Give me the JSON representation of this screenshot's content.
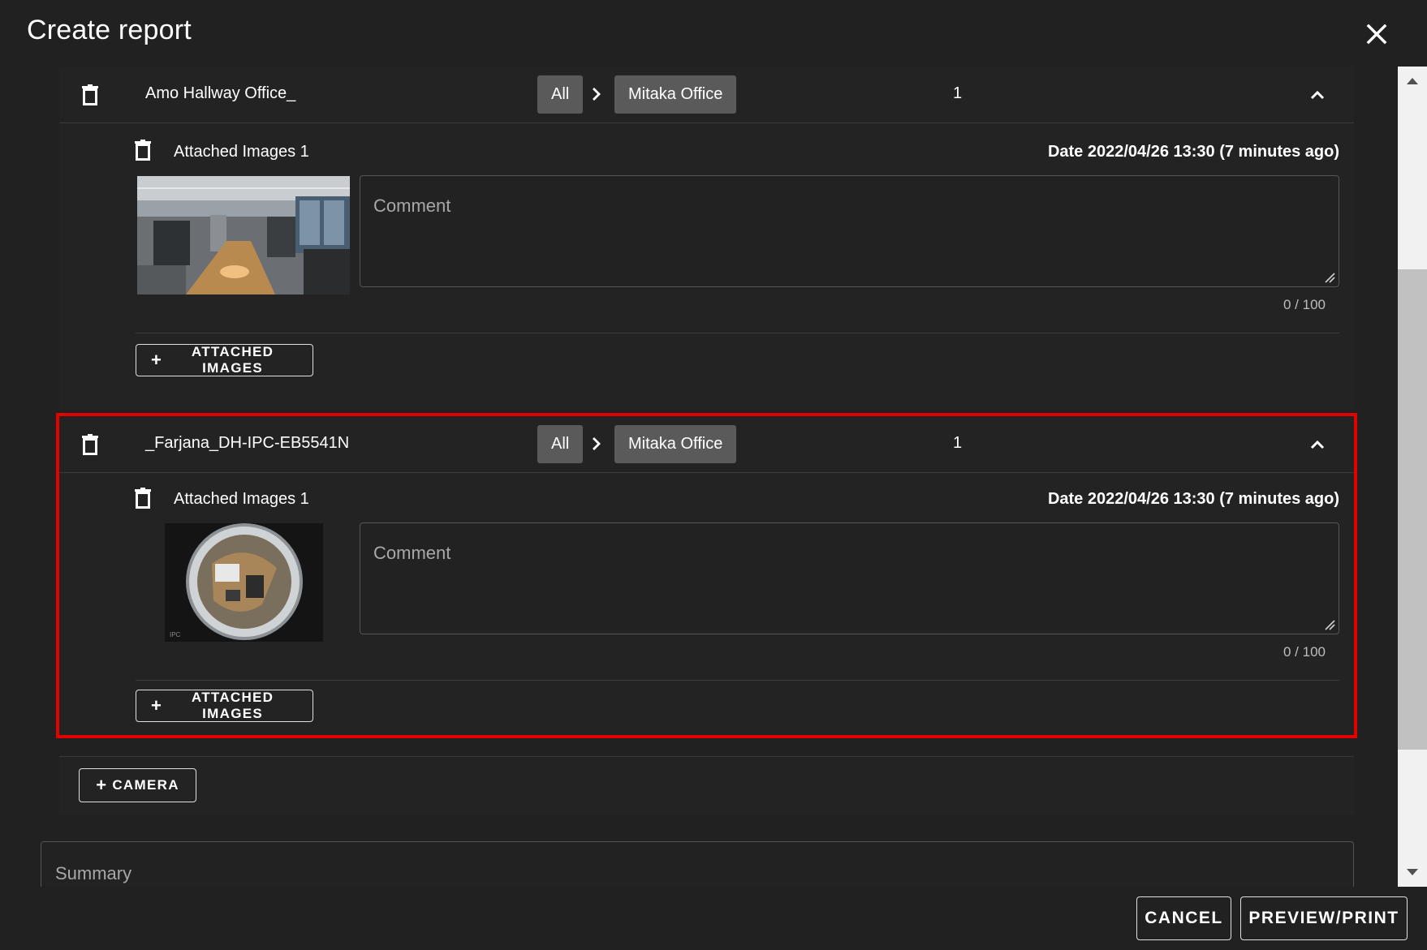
{
  "dialog": {
    "title": "Create report",
    "close_icon": "close-icon"
  },
  "cameras": [
    {
      "name": "Amo Hallway Office_",
      "breadcrumb_root": "All",
      "breadcrumb_location": "Mitaka Office",
      "count": "1",
      "attached_images_label": "Attached Images 1",
      "date": "Date 2022/04/26 13:30 (7 minutes ago)",
      "comment_placeholder": "Comment",
      "char_counter": "0 / 100",
      "add_images_label": "ATTACHED IMAGES"
    },
    {
      "name": "_Farjana_DH-IPC-EB5541N",
      "breadcrumb_root": "All",
      "breadcrumb_location": "Mitaka Office",
      "count": "1",
      "attached_images_label": "Attached Images 1",
      "date": "Date 2022/04/26 13:30 (7 minutes ago)",
      "comment_placeholder": "Comment",
      "char_counter": "0 / 100",
      "add_images_label": "ATTACHED IMAGES",
      "thumbnail_caption": "IPC"
    }
  ],
  "add_camera_label": "CAMERA",
  "summary_placeholder": "Summary",
  "footer": {
    "cancel_label": "CANCEL",
    "preview_label": "PREVIEW/PRINT"
  },
  "colors": {
    "background": "#212121",
    "highlight": "#e50000",
    "chip": "#5a5a5a"
  }
}
